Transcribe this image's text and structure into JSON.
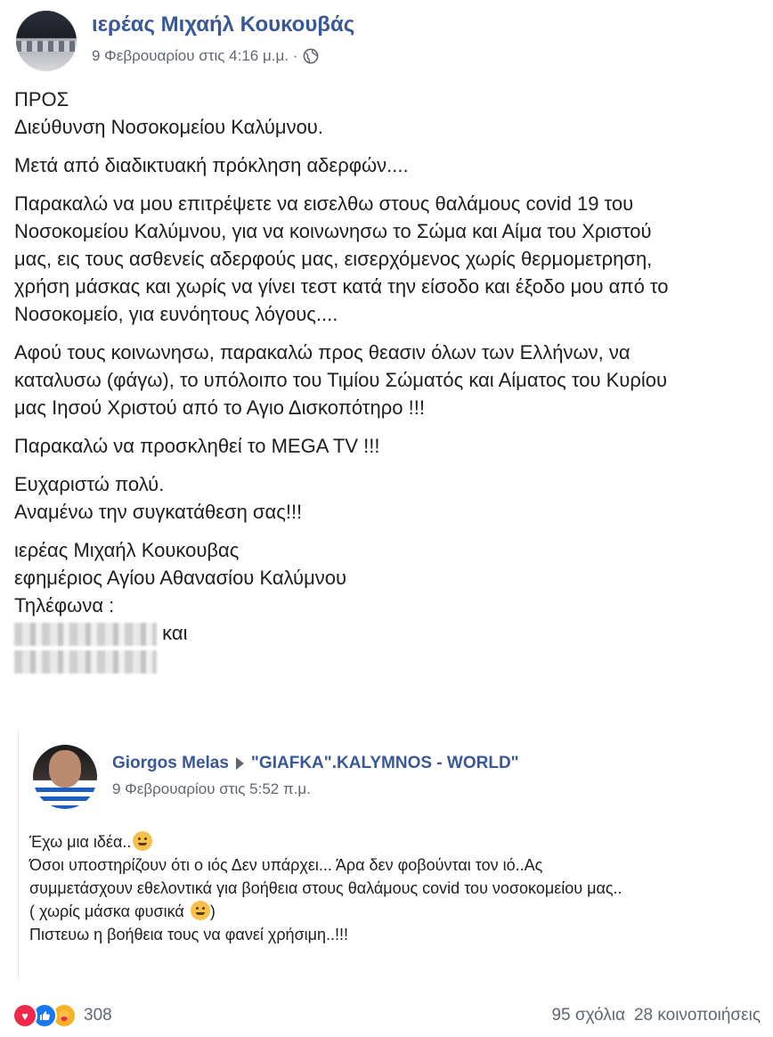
{
  "post": {
    "author": "ιερέας Μιχαήλ Κουκουβάς",
    "timestamp": "9 Φεβρουαρίου στις 4:16 μ.μ. ·",
    "privacy_icon": "globe-icon",
    "body": {
      "p1": [
        "ΠΡΟΣ",
        "Διεύθυνση Νοσοκομείου Καλύμνου."
      ],
      "p2": "Μετά από διαδικτυακή πρόκληση αδερφών....",
      "p3": [
        "Παρακαλώ να μου επιτρέψετε να εισελθω στους θαλάμους covid 19 του",
        "Νοσοκομείου Καλύμνου, για να κοινωνησω το Σώμα και Αίμα του Χριστού",
        "μας, εις τους ασθενείς αδερφούς μας, εισερχόμενος χωρίς θερμομετρηση,",
        "χρήση μάσκας και χωρίς να γίνει τεστ κατά την είσοδο και έξοδο μου από το",
        "Νοσοκομείο, για ευνόητους λόγους...."
      ],
      "p4": [
        "Αφού τους κοινωνησω, παρακαλώ προς θεασιν όλων των Ελλήνων, να",
        "καταλυσω (φάγω), το υπόλοιπο του Τιμίου Σώματός και Αίματος του Κυρίου",
        "μας Ιησού Χριστού από το Αγιο Δισκοπότηρο !!!"
      ],
      "p5": "Παρακαλώ να προσκληθεί το MEGA TV !!!",
      "p6": [
        "Ευχαριστώ πολύ.",
        "Αναμένω την συγκατάθεση σας!!!"
      ],
      "p7": [
        "ιερέας Μιχαήλ Κουκουβας",
        "εφημέριος Αγίου Αθανασίου Καλύμνου",
        "Τηλέφωνα :"
      ],
      "phone_joiner": "και"
    }
  },
  "shared": {
    "author": "Giorgos Melas",
    "group": "\"GIAFKA\".KALYMNOS - WORLD\"",
    "timestamp": "9 Φεβρουαρίου στις 5:52 π.μ.",
    "lines": [
      "Έχω μια ιδέα..",
      "Όσοι υποστηρίζουν ότι ο ιός Δεν υπάρχει... Άρα δεν φοβούνται τον ιό..Ας",
      "συμμετάσχουν εθελοντικά για βοήθεια στους θαλάμους covid του νοσοκομείου μας..",
      "( χωρίς μάσκα φυσικά ",
      "Πιστευω η βοήθεια τους να φανεί χρήσιμη..!!!"
    ],
    "line_end": ")"
  },
  "footer": {
    "reaction_count": "308",
    "comments": "95 σχόλια",
    "shares": "28 κοινοποιήσεις"
  },
  "colors": {
    "link_blue": "#385898",
    "meta_gray": "#616770",
    "love": "#f0284a",
    "like": "#1877f2",
    "care": "#f7b125"
  }
}
